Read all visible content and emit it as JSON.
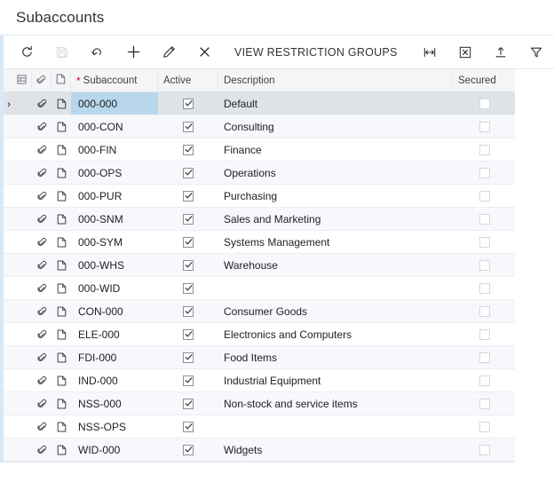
{
  "page_title": "Subaccounts",
  "toolbar": {
    "buttons": [
      {
        "name": "refresh",
        "icon": "refresh-icon",
        "label": "Refresh",
        "disabled": false
      },
      {
        "name": "save",
        "icon": "save-icon",
        "label": "Save",
        "disabled": true
      },
      {
        "name": "undo",
        "icon": "undo-icon",
        "label": "Undo",
        "disabled": false
      },
      {
        "name": "add",
        "icon": "plus-icon",
        "label": "Add New Record",
        "disabled": false
      },
      {
        "name": "edit",
        "icon": "pencil-icon",
        "label": "Edit",
        "disabled": false
      },
      {
        "name": "delete",
        "icon": "close-x-icon",
        "label": "Delete",
        "disabled": false
      }
    ],
    "action_label": "VIEW RESTRICTION GROUPS",
    "right_buttons": [
      {
        "name": "fit-columns",
        "icon": "fit-width-icon",
        "label": "Adjust Column Widths"
      },
      {
        "name": "export-excel",
        "icon": "excel-icon",
        "label": "Export to Excel"
      },
      {
        "name": "upload-file",
        "icon": "upload-icon",
        "label": "Load Records from File"
      },
      {
        "name": "filter",
        "icon": "filter-funnel-icon",
        "label": "Filter Settings"
      }
    ]
  },
  "grid": {
    "header_icons": [
      {
        "name": "column-config-icon",
        "glyph": "config"
      },
      {
        "name": "attachment-paperclip-icon",
        "glyph": "clip"
      },
      {
        "name": "note-file-icon",
        "glyph": "note"
      }
    ],
    "columns": [
      {
        "key": "subaccount",
        "label": "Subaccount",
        "required": true
      },
      {
        "key": "active",
        "label": "Active",
        "required": false
      },
      {
        "key": "description",
        "label": "Description",
        "required": false
      },
      {
        "key": "secured",
        "label": "Secured",
        "required": false
      }
    ],
    "rows": [
      {
        "subaccount": "000-000",
        "active": true,
        "description": "Default",
        "secured": false,
        "selected": true
      },
      {
        "subaccount": "000-CON",
        "active": true,
        "description": "Consulting",
        "secured": false,
        "selected": false
      },
      {
        "subaccount": "000-FIN",
        "active": true,
        "description": "Finance",
        "secured": false,
        "selected": false
      },
      {
        "subaccount": "000-OPS",
        "active": true,
        "description": "Operations",
        "secured": false,
        "selected": false
      },
      {
        "subaccount": "000-PUR",
        "active": true,
        "description": "Purchasing",
        "secured": false,
        "selected": false
      },
      {
        "subaccount": "000-SNM",
        "active": true,
        "description": "Sales and Marketing",
        "secured": false,
        "selected": false
      },
      {
        "subaccount": "000-SYM",
        "active": true,
        "description": "Systems Management",
        "secured": false,
        "selected": false
      },
      {
        "subaccount": "000-WHS",
        "active": true,
        "description": "Warehouse",
        "secured": false,
        "selected": false
      },
      {
        "subaccount": "000-WID",
        "active": true,
        "description": "",
        "secured": false,
        "selected": false
      },
      {
        "subaccount": "CON-000",
        "active": true,
        "description": "Consumer Goods",
        "secured": false,
        "selected": false
      },
      {
        "subaccount": "ELE-000",
        "active": true,
        "description": "Electronics and Computers",
        "secured": false,
        "selected": false
      },
      {
        "subaccount": "FDI-000",
        "active": true,
        "description": "Food Items",
        "secured": false,
        "selected": false
      },
      {
        "subaccount": "IND-000",
        "active": true,
        "description": "Industrial Equipment",
        "secured": false,
        "selected": false
      },
      {
        "subaccount": "NSS-000",
        "active": true,
        "description": "Non-stock and service items",
        "secured": false,
        "selected": false
      },
      {
        "subaccount": "NSS-OPS",
        "active": true,
        "description": "",
        "secured": false,
        "selected": false
      },
      {
        "subaccount": "WID-000",
        "active": true,
        "description": "Widgets",
        "secured": false,
        "selected": false
      }
    ]
  },
  "colors": {
    "accent_left": "#d9e8f5",
    "selected_row": "#dfe3e8",
    "selected_cell": "#b8d7ec",
    "header_bg": "#f4f5f7",
    "alt_row": "#f6f8fb",
    "required_star": "#d0021b"
  }
}
